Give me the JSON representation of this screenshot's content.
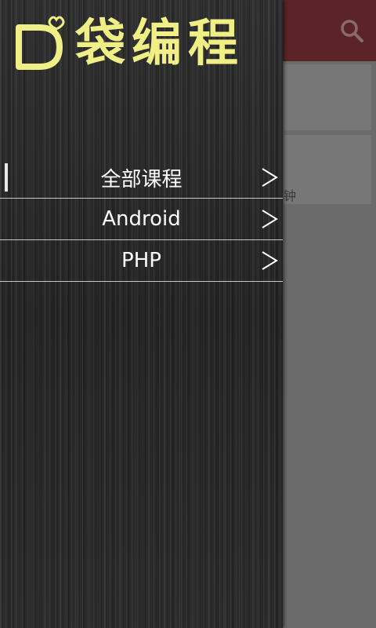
{
  "app": {
    "logo_text": "袋编程",
    "logo_mark": "D"
  },
  "colors": {
    "header_bg": "#5b2427",
    "logo_yellow": "#f0ef86",
    "drawer_wood": "#2a2a2a",
    "divider": "#c9c9c9"
  },
  "main": {
    "search_icon": "search-icon",
    "partial_text": "钟"
  },
  "menu": {
    "items": [
      {
        "label": "全部课程",
        "active": true
      },
      {
        "label": "Android",
        "active": false
      },
      {
        "label": "PHP",
        "active": false
      }
    ]
  }
}
